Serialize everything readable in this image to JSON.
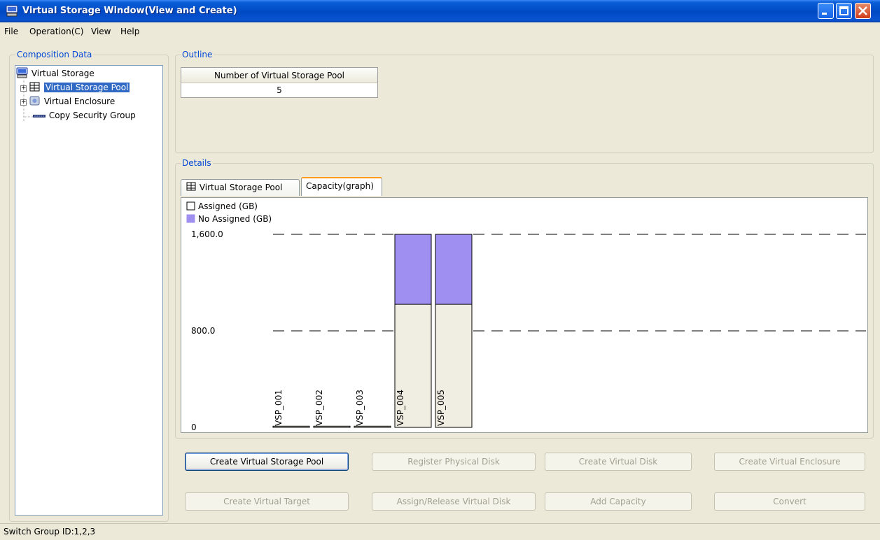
{
  "window": {
    "title": "Virtual Storage Window(View and Create)"
  },
  "menu": [
    {
      "label": "File"
    },
    {
      "label": "Operation(C)"
    },
    {
      "label": "View"
    },
    {
      "label": "Help"
    }
  ],
  "composition": {
    "legend": "Composition Data",
    "tree": [
      {
        "label": "Virtual Storage",
        "icon": "storage-icon"
      },
      {
        "label": "Virtual Storage Pool",
        "icon": "pool-icon",
        "selected": true
      },
      {
        "label": "Virtual Enclosure",
        "icon": "enclosure-icon"
      },
      {
        "label": "Copy Security Group",
        "icon": "security-group-icon"
      }
    ]
  },
  "outline": {
    "legend": "Outline",
    "header": "Number of Virtual Storage Pool",
    "value": "5"
  },
  "details": {
    "legend": "Details",
    "tabs": [
      {
        "label": "Virtual Storage Pool",
        "active": false
      },
      {
        "label": "Capacity(graph)",
        "active": true
      }
    ]
  },
  "chart_data": {
    "type": "bar",
    "stacked": true,
    "categories": [
      "VSP_001",
      "VSP_002",
      "VSP_003",
      "VSP_004",
      "VSP_005"
    ],
    "series": [
      {
        "name": "Assigned (GB)",
        "color": "#f0ede2",
        "values": [
          10,
          10,
          10,
          1020,
          1020
        ]
      },
      {
        "name": "No Assigned (GB)",
        "color": "#9f8ff0",
        "values": [
          0,
          0,
          0,
          580,
          580
        ]
      }
    ],
    "yticks": [
      "1,600.0",
      "800.0",
      "0"
    ],
    "ylim": [
      0,
      1600
    ],
    "gridlines": [
      1600,
      800
    ],
    "legend_position": "top-left"
  },
  "buttons": {
    "row1": [
      {
        "label": "Create Virtual Storage Pool",
        "enabled": true
      },
      {
        "label": "Register Physical Disk",
        "enabled": false
      },
      {
        "label": "Create Virtual Disk",
        "enabled": false
      },
      {
        "label": "Create Virtual Enclosure",
        "enabled": false
      }
    ],
    "row2": [
      {
        "label": "Create Virtual Target",
        "enabled": false
      },
      {
        "label": "Assign/Release Virtual Disk",
        "enabled": false
      },
      {
        "label": "Add Capacity",
        "enabled": false
      },
      {
        "label": "Convert",
        "enabled": false
      }
    ]
  },
  "status": {
    "text": "Switch Group ID:1,2,3"
  }
}
